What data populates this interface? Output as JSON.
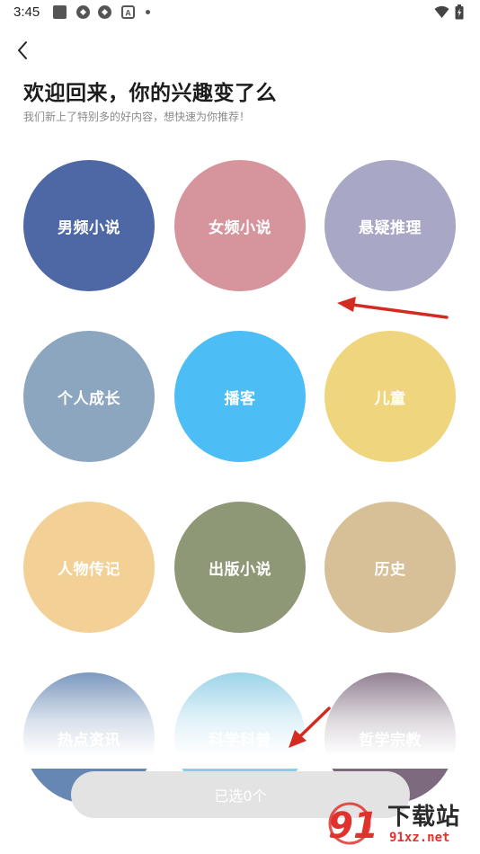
{
  "status_bar": {
    "time": "3:45",
    "icons": [
      "notification-square-icon",
      "app-shield-icon",
      "app-shield-icon",
      "a-box-icon",
      "wifi-icon",
      "battery-charging-icon"
    ]
  },
  "header": {
    "back_icon": "chevron-left-icon",
    "title": "欢迎回来，你的兴趣变了么",
    "subtitle": "我们新上了特别多的好内容，想快速为你推荐！"
  },
  "categories": [
    {
      "label": "男频小说",
      "color": "#4e67a5"
    },
    {
      "label": "女频小说",
      "color": "#d6949c"
    },
    {
      "label": "悬疑推理",
      "color": "#a8a8c6"
    },
    {
      "label": "个人成长",
      "color": "#8ca6bf"
    },
    {
      "label": "播客",
      "color": "#4cbdf5"
    },
    {
      "label": "儿童",
      "color": "#efd57d"
    },
    {
      "label": "人物传记",
      "color": "#f3d096"
    },
    {
      "label": "出版小说",
      "color": "#8e9876"
    },
    {
      "label": "历史",
      "color": "#d7c097"
    },
    {
      "label": "热点资讯",
      "color": "#6687b3"
    },
    {
      "label": "科学科普",
      "color": "#8ccde6"
    },
    {
      "label": "哲学宗教",
      "color": "#7e6a7e"
    }
  ],
  "footer": {
    "selected_label": "已选0个"
  },
  "watermark": {
    "brand": "下载站",
    "domain": "91xz.net",
    "logo_text": "91"
  },
  "colors": {
    "annotation_arrow": "#d42a20",
    "button_bg": "#e3e3e3"
  }
}
